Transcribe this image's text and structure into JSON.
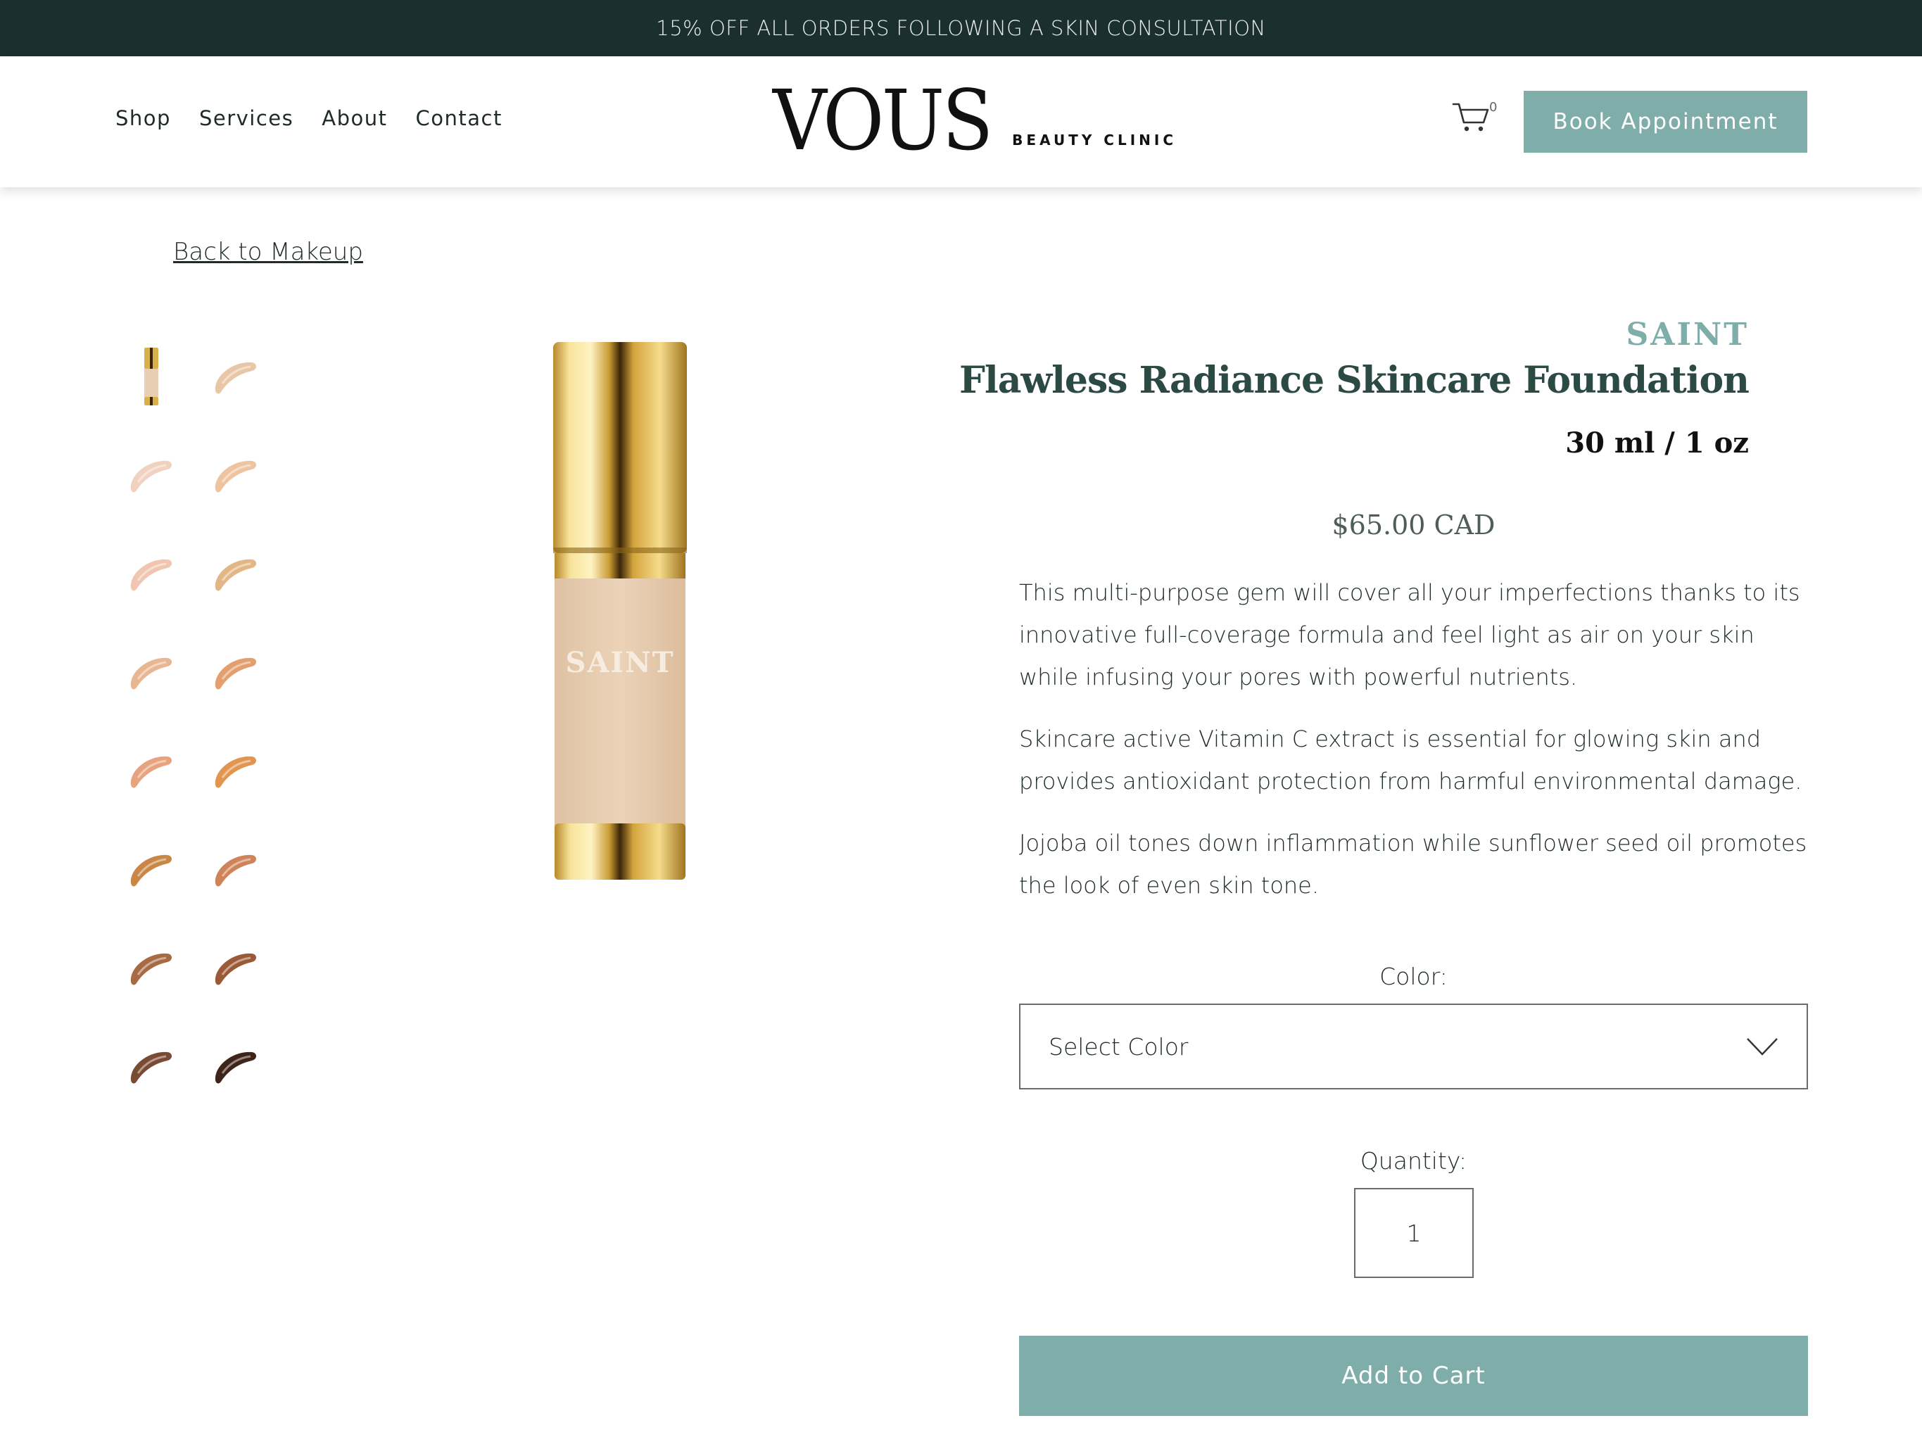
{
  "announcement": "15% OFF ALL ORDERS FOLLOWING A SKIN CONSULTATION",
  "nav": {
    "items": [
      "Shop",
      "Services",
      "About",
      "Contact"
    ]
  },
  "logo": {
    "main": "VOUS",
    "sub": "BEAUTY CLINIC"
  },
  "cart": {
    "count": "0",
    "icon": "cart-icon"
  },
  "header": {
    "book_label": "Book Appointment"
  },
  "back_link": "Back to Makeup",
  "product": {
    "brand": "SAINT",
    "title": "Flawless Radiance Skincare Foundation",
    "size": "30 ml / 1 oz",
    "price": "$65.00 CAD",
    "bottle_label": "SAINT",
    "description": [
      "This multi-purpose gem will cover all your imperfections thanks to its innovative full-coverage formula and feel light as air on your skin while infusing your pores with powerful nutrients.",
      "Skincare active Vitamin C extract is essential for glowing skin and provides antioxidant protection from harmful environmental damage.",
      "Jojoba oil tones down inflammation while sunflower seed oil promotes the look of even skin tone."
    ],
    "thumbnails": [
      "#e8c7a6",
      "#f1d2c0",
      "#eec39f",
      "#f0c5b1",
      "#e3b686",
      "#e8b792",
      "#e49f6f",
      "#e7a27e",
      "#e1954f",
      "#c98645",
      "#cf8359",
      "#a86a43",
      "#9b5a37",
      "#7a4b33",
      "#3e2419"
    ]
  },
  "options": {
    "color_label": "Color:",
    "color_value": "Select Color",
    "quantity_label": "Quantity:",
    "quantity_value": "1"
  },
  "add_to_cart_label": "Add to Cart"
}
